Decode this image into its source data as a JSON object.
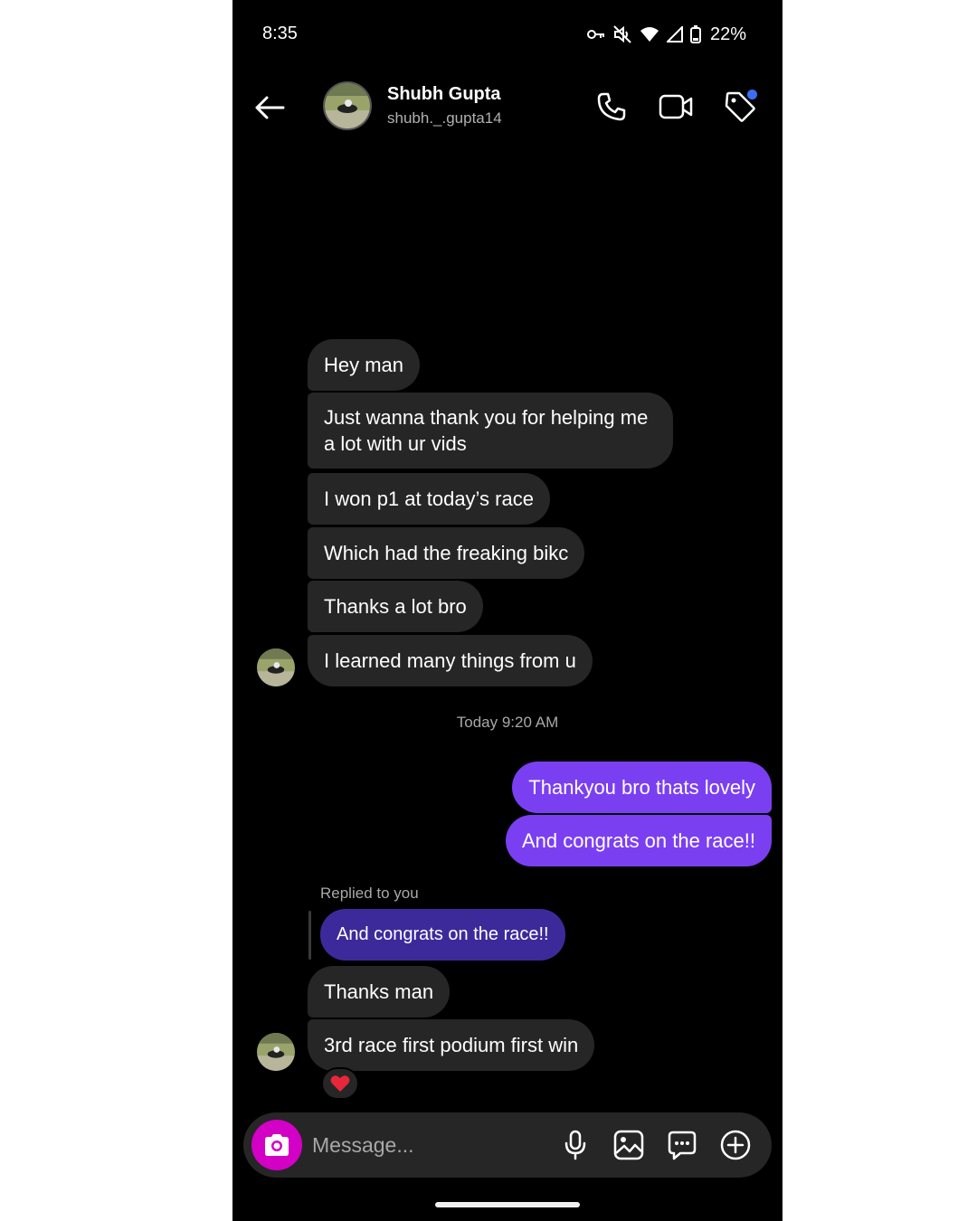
{
  "status_bar": {
    "time": "8:35",
    "battery": "22%",
    "icons": [
      "vpn-key-icon",
      "mute-icon",
      "wifi-icon",
      "signal-icon",
      "battery-icon"
    ]
  },
  "header": {
    "name": "Shubh Gupta",
    "handle": "shubh._.gupta14",
    "icons": [
      "back-arrow-icon",
      "phone-icon",
      "video-icon",
      "tag-icon"
    ],
    "notification_color": "#3b6ef5"
  },
  "messages": {
    "incoming_1": "Hey man",
    "incoming_2": "Just wanna thank you for helping me a lot with ur vids",
    "incoming_3": "I won p1 at today’s race",
    "incoming_4": "Which had the freaking bikc",
    "incoming_5": "Thanks a lot bro",
    "incoming_6": "I learned many things from u",
    "timestamp": "Today 9:20 AM",
    "outgoing_1": "Thankyou bro thats lovely",
    "outgoing_2": "And congrats on the race!!",
    "reply_label": "Replied to you",
    "reply_quote": "And congrats on the race!!",
    "incoming_7": "Thanks man",
    "incoming_8": "3rd race first podium first win",
    "reaction": "heart-emoji"
  },
  "composer": {
    "placeholder": "Message...",
    "icons": [
      "camera-icon",
      "microphone-icon",
      "gallery-icon",
      "sticker-icon",
      "plus-icon"
    ]
  },
  "colors": {
    "incoming_bubble": "#262626",
    "outgoing_bubble": "#7b3ff2",
    "reply_bubble": "#3d2a9a",
    "camera_button": "#d300c5"
  }
}
